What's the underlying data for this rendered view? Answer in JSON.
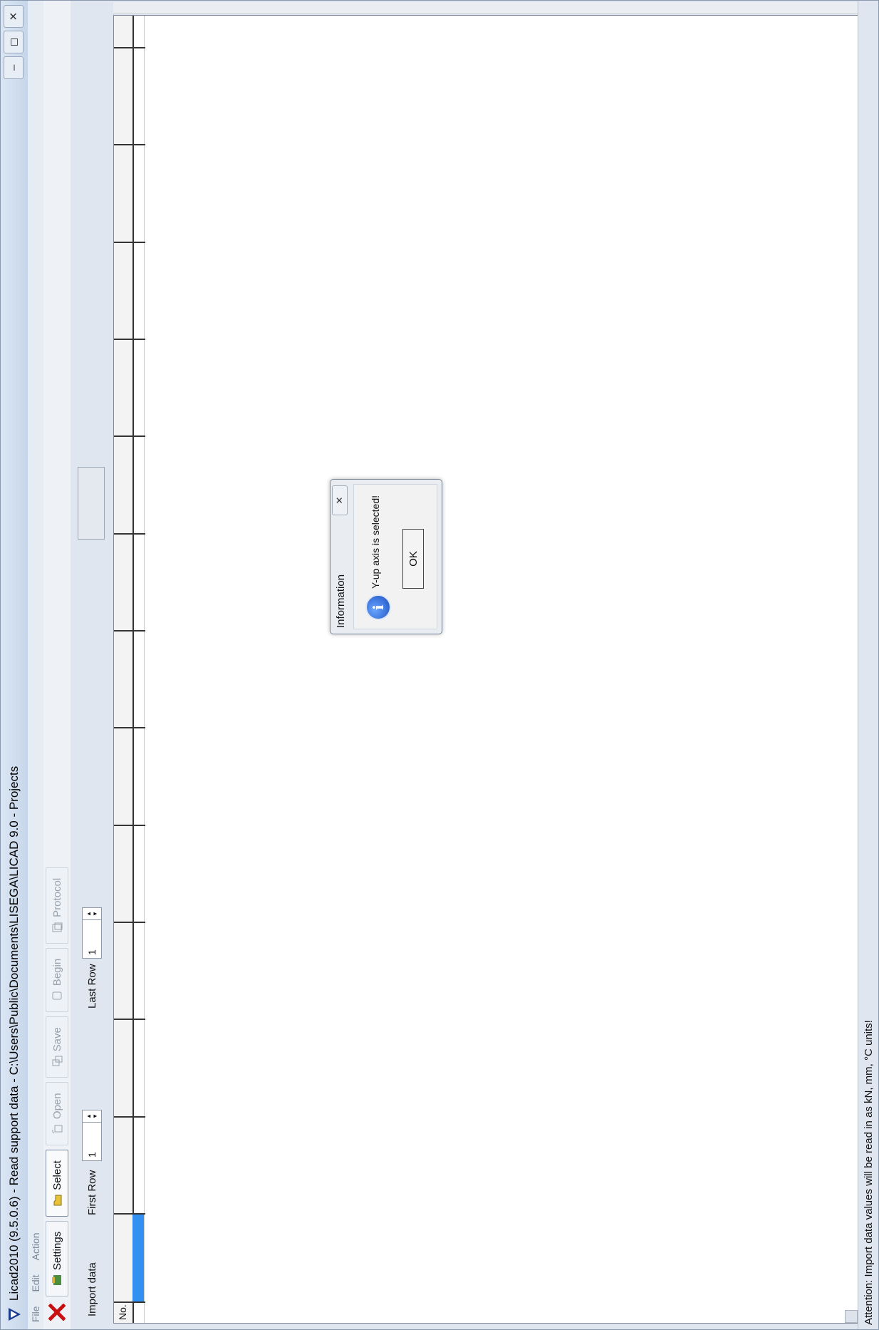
{
  "window": {
    "title": "Licad2010 (9.5.0.6) - Read support data - C:\\Users\\Public\\Documents\\LISEGA\\LICAD 9.0 - Projects",
    "controls": {
      "minimize": "–",
      "maximize": "◻",
      "close": "✕"
    }
  },
  "menu": [
    "File",
    "Edit",
    "Action"
  ],
  "toolbar": {
    "settings": "Settings",
    "select": "Select",
    "open": "Open",
    "save": "Save",
    "begin": "Begin",
    "protocol": "Protocol"
  },
  "options": {
    "import_label": "Import data",
    "first_row_label": "First Row",
    "first_row_value": "1",
    "last_row_label": "Last Row",
    "last_row_value": "1"
  },
  "grid": {
    "header_no": "No."
  },
  "status": "Attention: Import data values will be read in as kN, mm, °C units!",
  "dialog": {
    "title": "Information",
    "message": "Y-up axis is selected!",
    "ok": "OK",
    "close": "✕"
  },
  "colors": {
    "selection": "#3390f0",
    "info_icon": "#1a4fc0"
  }
}
